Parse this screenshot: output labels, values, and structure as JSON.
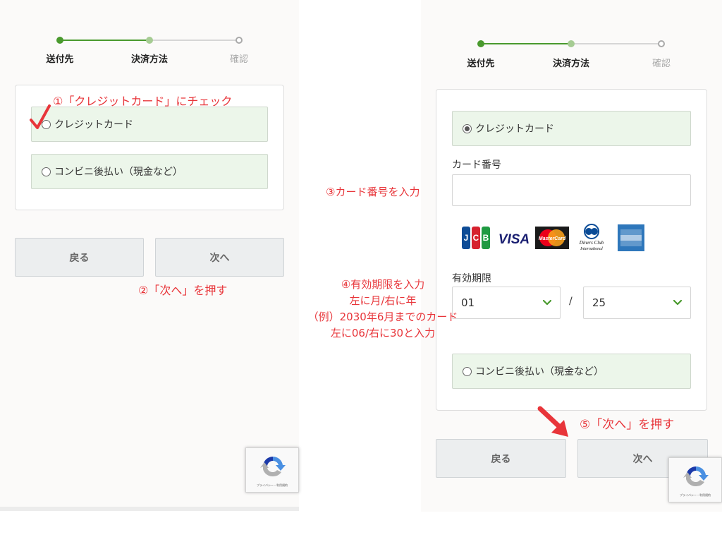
{
  "stepper": {
    "steps": [
      "送付先",
      "決済方法",
      "確認"
    ]
  },
  "left": {
    "options": {
      "credit": "クレジットカード",
      "konbini": "コンビニ後払い（現金など）"
    },
    "buttons": {
      "back": "戻る",
      "next": "次へ"
    }
  },
  "right": {
    "options": {
      "credit": "クレジットカード",
      "konbini": "コンビニ後払い（現金など）"
    },
    "card_number_label": "カード番号",
    "card_brands": [
      "JCB",
      "VISA",
      "MasterCard",
      "Diners Club International",
      "American Express"
    ],
    "expiry_label": "有効期限",
    "expiry_month": "01",
    "expiry_separator": "/",
    "expiry_year": "25",
    "buttons": {
      "back": "戻る",
      "next": "次へ"
    }
  },
  "annotations": {
    "step1": "①「クレジットカード」にチェック",
    "step2": "②「次へ」を押す",
    "step3": "③カード番号を入力",
    "step4": [
      "④有効期限を入力",
      "左に月/右に年",
      "（例）2030年6月までのカード",
      "左に06/右に30と入力"
    ],
    "step5": "⑤「次へ」を押す"
  },
  "recaptcha": {
    "caption": "プライバシー・利用規約"
  },
  "colors": {
    "accent_green": "#4a9a2e",
    "light_green": "#a6cc93",
    "option_bg": "#ecf6ea",
    "annotation_red": "#e8353a"
  }
}
